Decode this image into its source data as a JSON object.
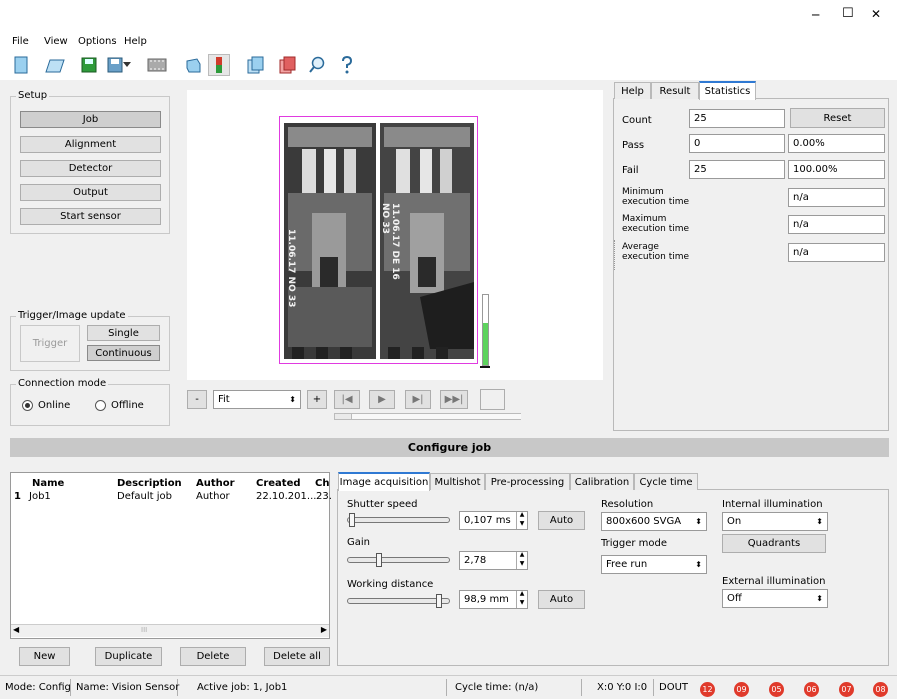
{
  "window": {
    "minimize": "─",
    "maximize": "☐",
    "close": "✕"
  },
  "menu": [
    "File",
    "View",
    "Options",
    "Help"
  ],
  "toolbar": {
    "icons": [
      "new-icon",
      "open-icon",
      "save-icon",
      "save-as-icon",
      "dropdown-icon",
      "filmstrip-icon",
      "camera-icon",
      "sensor-icon",
      "copy-icon",
      "export-icon",
      "search-icon",
      "help-icon"
    ]
  },
  "setup": {
    "title": "Setup",
    "buttons": [
      "Job",
      "Alignment",
      "Detector",
      "Output",
      "Start sensor"
    ]
  },
  "trigger": {
    "title": "Trigger/Image update",
    "trigger": "Trigger",
    "single": "Single",
    "continuous": "Continuous"
  },
  "connection": {
    "title": "Connection mode",
    "online": "Online",
    "offline": "Offline"
  },
  "image": {
    "zoom_minus": "-",
    "zoom": "Fit",
    "zoom_plus": "+",
    "label_left": "11.06.17 NO 33",
    "label_right": "11.06.17 DE 16 NO 33",
    "level": 0.6
  },
  "right_tabs": [
    "Help",
    "Result",
    "Statistics"
  ],
  "stats": {
    "count_label": "Count",
    "count": "25",
    "reset": "Reset",
    "pass_label": "Pass",
    "pass": "0",
    "pass_pct": "0.00%",
    "fail_label": "Fail",
    "fail": "25",
    "fail_pct": "100.00%",
    "min_label": "Minimum\nexecution time",
    "min": "n/a",
    "max_label": "Maximum\nexecution time",
    "max": "n/a",
    "avg_label": "Average\nexecution time",
    "avg": "n/a"
  },
  "configure_title": "Configure job",
  "jobs": {
    "headers": [
      "Name",
      "Description",
      "Author",
      "Created",
      "Ch"
    ],
    "rows": [
      [
        "1",
        "Job1",
        "Default job",
        "Author",
        "22.10.201...",
        "23."
      ]
    ],
    "scroll_mark": "III"
  },
  "job_buttons": [
    "New",
    "Duplicate",
    "Delete",
    "Delete all"
  ],
  "config_tabs": [
    "Image acquisition",
    "Multishot",
    "Pre-processing",
    "Calibration",
    "Cycle time"
  ],
  "acq": {
    "shutter_label": "Shutter speed",
    "shutter": "0,107 ms",
    "shutter_pos": 0.02,
    "auto1": "Auto",
    "gain_label": "Gain",
    "gain": "2,78",
    "gain_pos": 0.3,
    "wd_label": "Working distance",
    "wd": "98,9 mm",
    "wd_pos": 0.92,
    "auto2": "Auto",
    "res_label": "Resolution",
    "res": "800x600 SVGA",
    "trig_label": "Trigger mode",
    "trig": "Free run",
    "int_label": "Internal illumination",
    "int": "On",
    "quadrants": "Quadrants",
    "ext_label": "External illumination",
    "ext": "Off"
  },
  "status": {
    "mode": "Mode:  Config",
    "name": "Name:  Vision Sensor",
    "active": "Active job:  1, Job1",
    "cycle": "Cycle time:  (n/a)",
    "xy": "X:0 Y:0 I:0",
    "dout": "DOUT",
    "outputs": [
      "12",
      "09",
      "05",
      "06",
      "07",
      "08"
    ]
  },
  "colors": {
    "accent": "#2f79d3",
    "output_red": "#e03a2b",
    "level_green": "#5dd35d",
    "roi": "#e03ae0"
  }
}
